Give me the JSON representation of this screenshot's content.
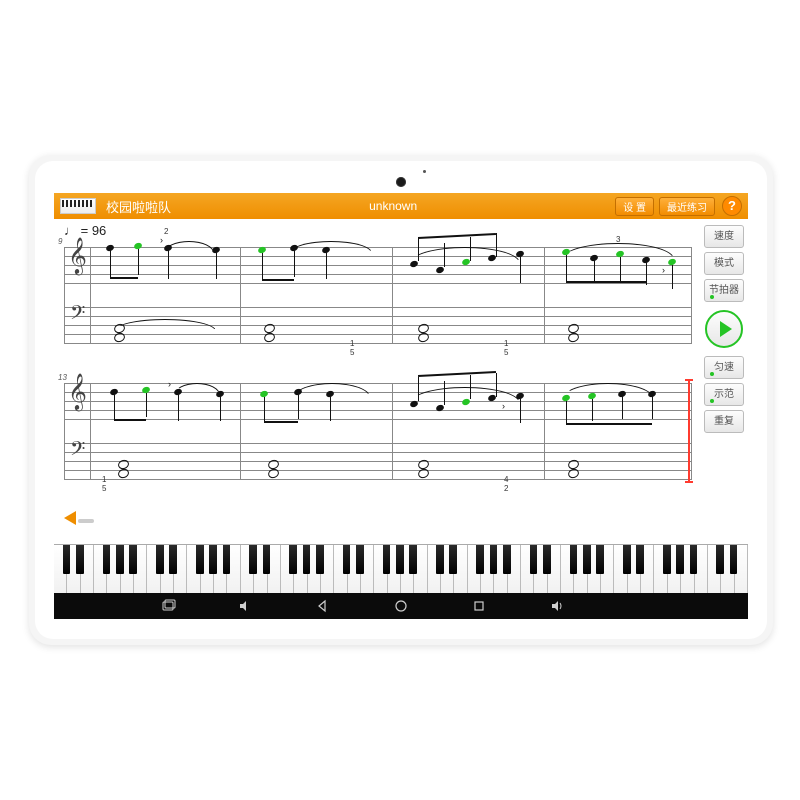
{
  "topbar": {
    "song_title": "校园啦啦队",
    "center": "unknown",
    "settings": "设 置",
    "recent": "最近练习",
    "help": "?"
  },
  "tempo": {
    "marking": "♩ = 96",
    "value": 96
  },
  "measure_markers": {
    "sys1": "9",
    "sys2": "13"
  },
  "side_buttons": {
    "speed": "速度",
    "mode": "模式",
    "metronome": "节拍器",
    "uniform": "匀速",
    "demo": "示范",
    "repeat": "重复"
  }
}
